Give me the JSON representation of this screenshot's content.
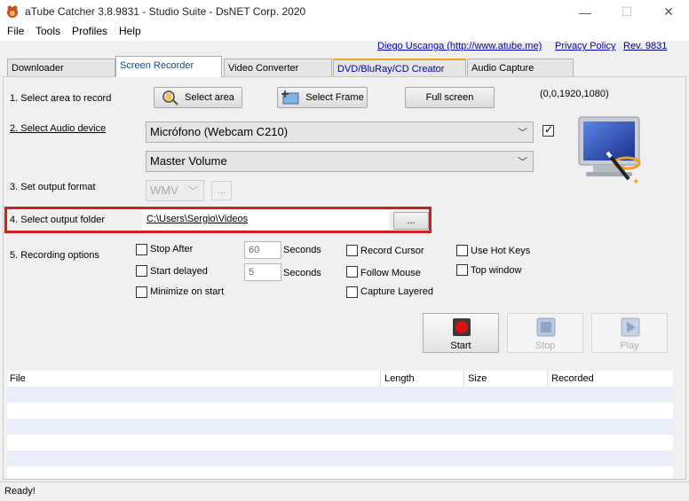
{
  "window": {
    "title": "aTube Catcher 3.8.9831 - Studio Suite - DsNET Corp. 2020",
    "minimize": "—",
    "maximize": "☐",
    "close": "✕"
  },
  "menu": [
    "File",
    "Tools",
    "Profiles",
    "Help"
  ],
  "links": {
    "author": "Diego Uscanga (http://www.atube.me)",
    "privacy": "Privacy Policy",
    "rev": "Rev. 9831"
  },
  "tabs": [
    "Downloader",
    "Screen Recorder",
    "Video Converter",
    "DVD/BluRay/CD Creator",
    "Audio Capture"
  ],
  "steps": {
    "area": {
      "label": "1. Select area to record",
      "select_area": "Select area",
      "select_frame": "Select Frame",
      "full_screen": "Full screen",
      "coords": "(0,0,1920,1080)"
    },
    "audio": {
      "label": "2. Select Audio device",
      "device": "Micrófono (Webcam C210)",
      "volume": "Master Volume"
    },
    "format": {
      "label": "3. Set output format",
      "value": "WMV",
      "more": "..."
    },
    "folder": {
      "label": "4. Select output folder",
      "path": "C:\\Users\\Sergio\\Videos",
      "browse": "..."
    },
    "options": {
      "label": "5. Recording options",
      "stop_after": "Stop After",
      "stop_after_value": "60",
      "seconds1": "Seconds",
      "start_delayed": "Start delayed",
      "start_delayed_value": "5",
      "seconds2": "Seconds",
      "minimize": "Minimize on start",
      "record_cursor": "Record Cursor",
      "follow_mouse": "Follow Mouse",
      "capture_layered": "Capture Layered",
      "hot_keys": "Use Hot Keys",
      "top_window": "Top window"
    }
  },
  "controls": {
    "start": "Start",
    "stop": "Stop",
    "play": "Play"
  },
  "list": {
    "columns": [
      "File",
      "Length",
      "Size",
      "Recorded"
    ]
  },
  "status": "Ready!",
  "colors": {
    "highlight": "#cc2222",
    "link": "#0000cc",
    "row_alt": "#eaedfa"
  }
}
